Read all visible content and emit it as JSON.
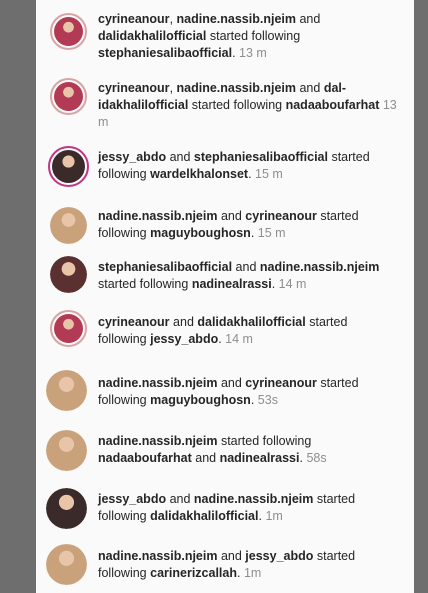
{
  "activity": [
    {
      "actor1": "cyrineanour",
      "sep1": ", ",
      "actor2": "nadine.nassib.njeim",
      "sep2": " and ",
      "actor3": "dalidakhalilofficial",
      "verb": " started following ",
      "target1": "stephaniesalibaofficial",
      "sep3": "",
      "target2": "",
      "end": ".",
      "time": " 13 m",
      "avatar_color": "#b23a55"
    },
    {
      "actor1": "cyrineanour",
      "sep1": ", ",
      "actor2": "nadine.nassib.njeim",
      "sep2": " and ",
      "actor3": "dal-idakhalilofficial",
      "verb": " started following ",
      "target1": "nadaaboufarhat",
      "sep3": "",
      "target2": "",
      "end": "",
      "time": " 13 m",
      "avatar_color": "#b23a55"
    },
    {
      "actor1": "jessy_abdo",
      "sep1": " and ",
      "actor2": "stephaniesalibaofficial",
      "sep2": "",
      "actor3": "",
      "verb": " started following ",
      "target1": "wardelkhalonset",
      "sep3": "",
      "target2": "",
      "end": ".",
      "time": " 15 m",
      "avatar_color": "#3a2a2a"
    },
    {
      "actor1": "nadine.nassib.njeim",
      "sep1": " and ",
      "actor2": "cyrineanour",
      "sep2": "",
      "actor3": "",
      "verb": " started following ",
      "target1": "maguyboughosn",
      "sep3": "",
      "target2": "",
      "end": ".",
      "time": " 15 m",
      "avatar_color": "#c9a27c"
    },
    {
      "actor1": "stephaniesalibaofficial",
      "sep1": " and ",
      "actor2": "nadine.nassib.njeim",
      "sep2": "",
      "actor3": "",
      "verb": " started following ",
      "target1": "nadinealrassi",
      "sep3": "",
      "target2": "",
      "end": ".",
      "time": " 14 m",
      "avatar_color": "#5a3030"
    },
    {
      "actor1": "cyrineanour",
      "sep1": " and ",
      "actor2": "dalidakhalilofficial",
      "sep2": "",
      "actor3": "",
      "verb": " started following ",
      "target1": "jessy_abdo",
      "sep3": "",
      "target2": "",
      "end": ".",
      "time": " 14 m",
      "avatar_color": "#b23a55"
    },
    {
      "actor1": "nadine.nassib.njeim",
      "sep1": " and ",
      "actor2": "cyrineanour",
      "sep2": "",
      "actor3": "",
      "verb": " started following ",
      "target1": "maguyboughosn",
      "sep3": "",
      "target2": "",
      "end": ".",
      "time": " 53s",
      "avatar_color": "#c9a27c"
    },
    {
      "actor1": "nadine.nassib.njeim",
      "sep1": "",
      "actor2": "",
      "sep2": "",
      "actor3": "",
      "verb": " started following ",
      "target1": "nadaaboufarhat",
      "sep3": " and ",
      "target2": "nadinealrassi",
      "end": ".",
      "time": " 58s",
      "avatar_color": "#c9a27c"
    },
    {
      "actor1": "jessy_abdo",
      "sep1": " and ",
      "actor2": "nadine.nassib.njeim",
      "sep2": "",
      "actor3": "",
      "verb": " started following ",
      "target1": "dalidakhalilofficial",
      "sep3": "",
      "target2": "",
      "end": ".",
      "time": " 1m",
      "avatar_color": "#3a2a2a"
    },
    {
      "actor1": "nadine.nassib.njeim",
      "sep1": " and ",
      "actor2": "jessy_abdo",
      "sep2": "",
      "actor3": "",
      "verb": " started following ",
      "target1": "carinerizcallah",
      "sep3": "",
      "target2": "",
      "end": ".",
      "time": " 1m",
      "avatar_color": "#c9a27c"
    }
  ]
}
